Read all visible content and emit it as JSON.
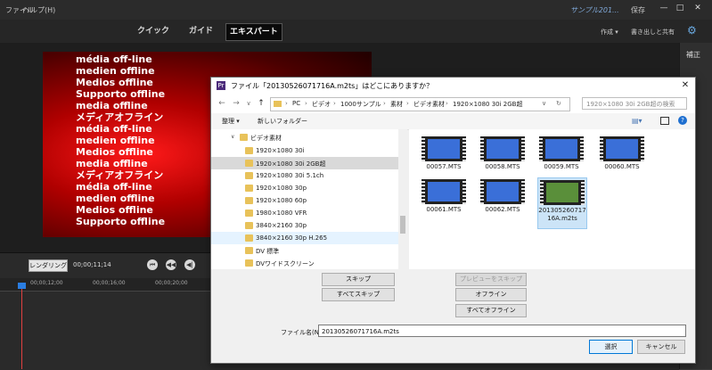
{
  "app": {
    "menu": [
      "ファイル",
      "ヘルプ(H)"
    ],
    "project_title": "サンプル201...",
    "save_label": "保存",
    "window_buttons": [
      "—",
      "□",
      "✕"
    ]
  },
  "modes": [
    "クイック",
    "ガイド",
    "エキスパート"
  ],
  "top_right": {
    "create": "作成 ▾",
    "export": "書き出しと共有"
  },
  "right_panel": {
    "adjust": "補正"
  },
  "preview_lines": [
    "média off-line",
    "medien offline",
    "Medios offline",
    "Supporto offline",
    "media offline",
    "メディアオフライン",
    "média off-line",
    "medien offline",
    "Medios offline",
    "media offline",
    "メディアオフライン",
    "média off-line",
    "medien offline",
    "Medios offline",
    "Supporto offline"
  ],
  "timeline": {
    "render_label": "レンダリング",
    "timecode": "00;00;11;14",
    "ruler": [
      "00;00;12;00",
      "00;00;16;00",
      "00;00;20;00"
    ],
    "transport": [
      "⏮",
      "◀◀",
      "◀|"
    ]
  },
  "dialog": {
    "title": "ファイル「20130526071716A.m2ts」はどこにありますか？",
    "icon": "Pr",
    "breadcrumb": [
      "PC",
      "ビデオ",
      "1000サンプル",
      "素材",
      "ビデオ素材",
      "1920×1080 30i 2GB超"
    ],
    "search_placeholder": "1920×1080 30i 2GB超の検索",
    "organize": "整理 ▾",
    "new_folder": "新しいフォルダー",
    "tree": [
      {
        "label": "ビデオ素材",
        "indent": 0
      },
      {
        "label": "1920×1080 30i",
        "indent": 1
      },
      {
        "label": "1920×1080 30i 2GB超",
        "indent": 1,
        "selected": true
      },
      {
        "label": "1920×1080 30i 5.1ch",
        "indent": 1
      },
      {
        "label": "1920×1080 30p",
        "indent": 1
      },
      {
        "label": "1920×1080 60p",
        "indent": 1
      },
      {
        "label": "1980×1080 VFR",
        "indent": 1
      },
      {
        "label": "3840×2160 30p",
        "indent": 1
      },
      {
        "label": "3840×2160 30p H.265",
        "indent": 1,
        "hover": true
      },
      {
        "label": "DV 標準",
        "indent": 1
      },
      {
        "label": "DVワイドスクリーン",
        "indent": 1
      }
    ],
    "files": [
      {
        "name": "00057.MTS"
      },
      {
        "name": "00058.MTS"
      },
      {
        "name": "00059.MTS"
      },
      {
        "name": "00060.MTS"
      },
      {
        "name": "00061.MTS"
      },
      {
        "name": "00062.MTS"
      },
      {
        "name": "20130526071716A.m2ts",
        "selected": true
      }
    ],
    "buttons": {
      "skip": "スキップ",
      "skip_all": "すべてスキップ",
      "skip_preview": "プレビューをスキップ",
      "offline": "オフライン",
      "all_offline": "すべてオフライン"
    },
    "filename_label": "ファイル名(N):",
    "filename_value": "20130526071716A.m2ts",
    "ok": "選択",
    "cancel": "キャンセル"
  }
}
